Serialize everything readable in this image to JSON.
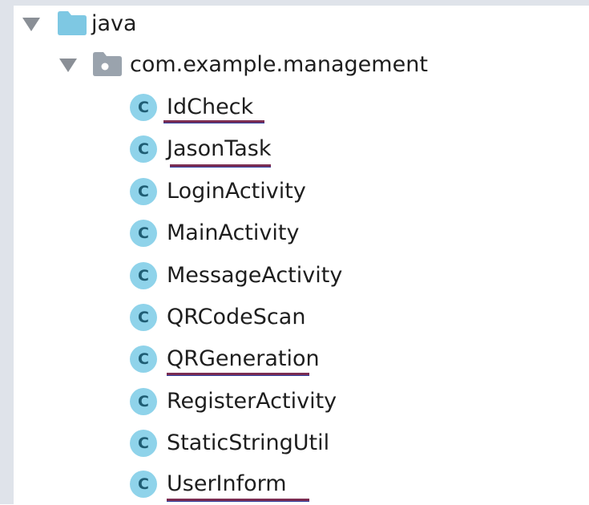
{
  "tree": {
    "root": {
      "label": "java",
      "icon": "folder-icon",
      "expanded": true
    },
    "package": {
      "label": "com.example.management",
      "icon": "package-folder-icon",
      "expanded": true
    },
    "class_icon_glyph": "C",
    "classes": [
      {
        "label": "IdCheck",
        "underlined": true
      },
      {
        "label": "JasonTask",
        "underlined": true
      },
      {
        "label": "LoginActivity",
        "underlined": false
      },
      {
        "label": "MainActivity",
        "underlined": false
      },
      {
        "label": "MessageActivity",
        "underlined": false
      },
      {
        "label": "QRCodeScan",
        "underlined": false
      },
      {
        "label": "QRGeneration",
        "underlined": true
      },
      {
        "label": "RegisterActivity",
        "underlined": false
      },
      {
        "label": "StaticStringUtil",
        "underlined": false
      },
      {
        "label": "UserInform",
        "underlined": true
      }
    ]
  },
  "colors": {
    "class_icon": "#8fd3ea",
    "folder_icon": "#7ec8e3",
    "package_icon": "#9aa3ad",
    "underline": "#7b2d52",
    "frame": "#dfe3ea"
  }
}
